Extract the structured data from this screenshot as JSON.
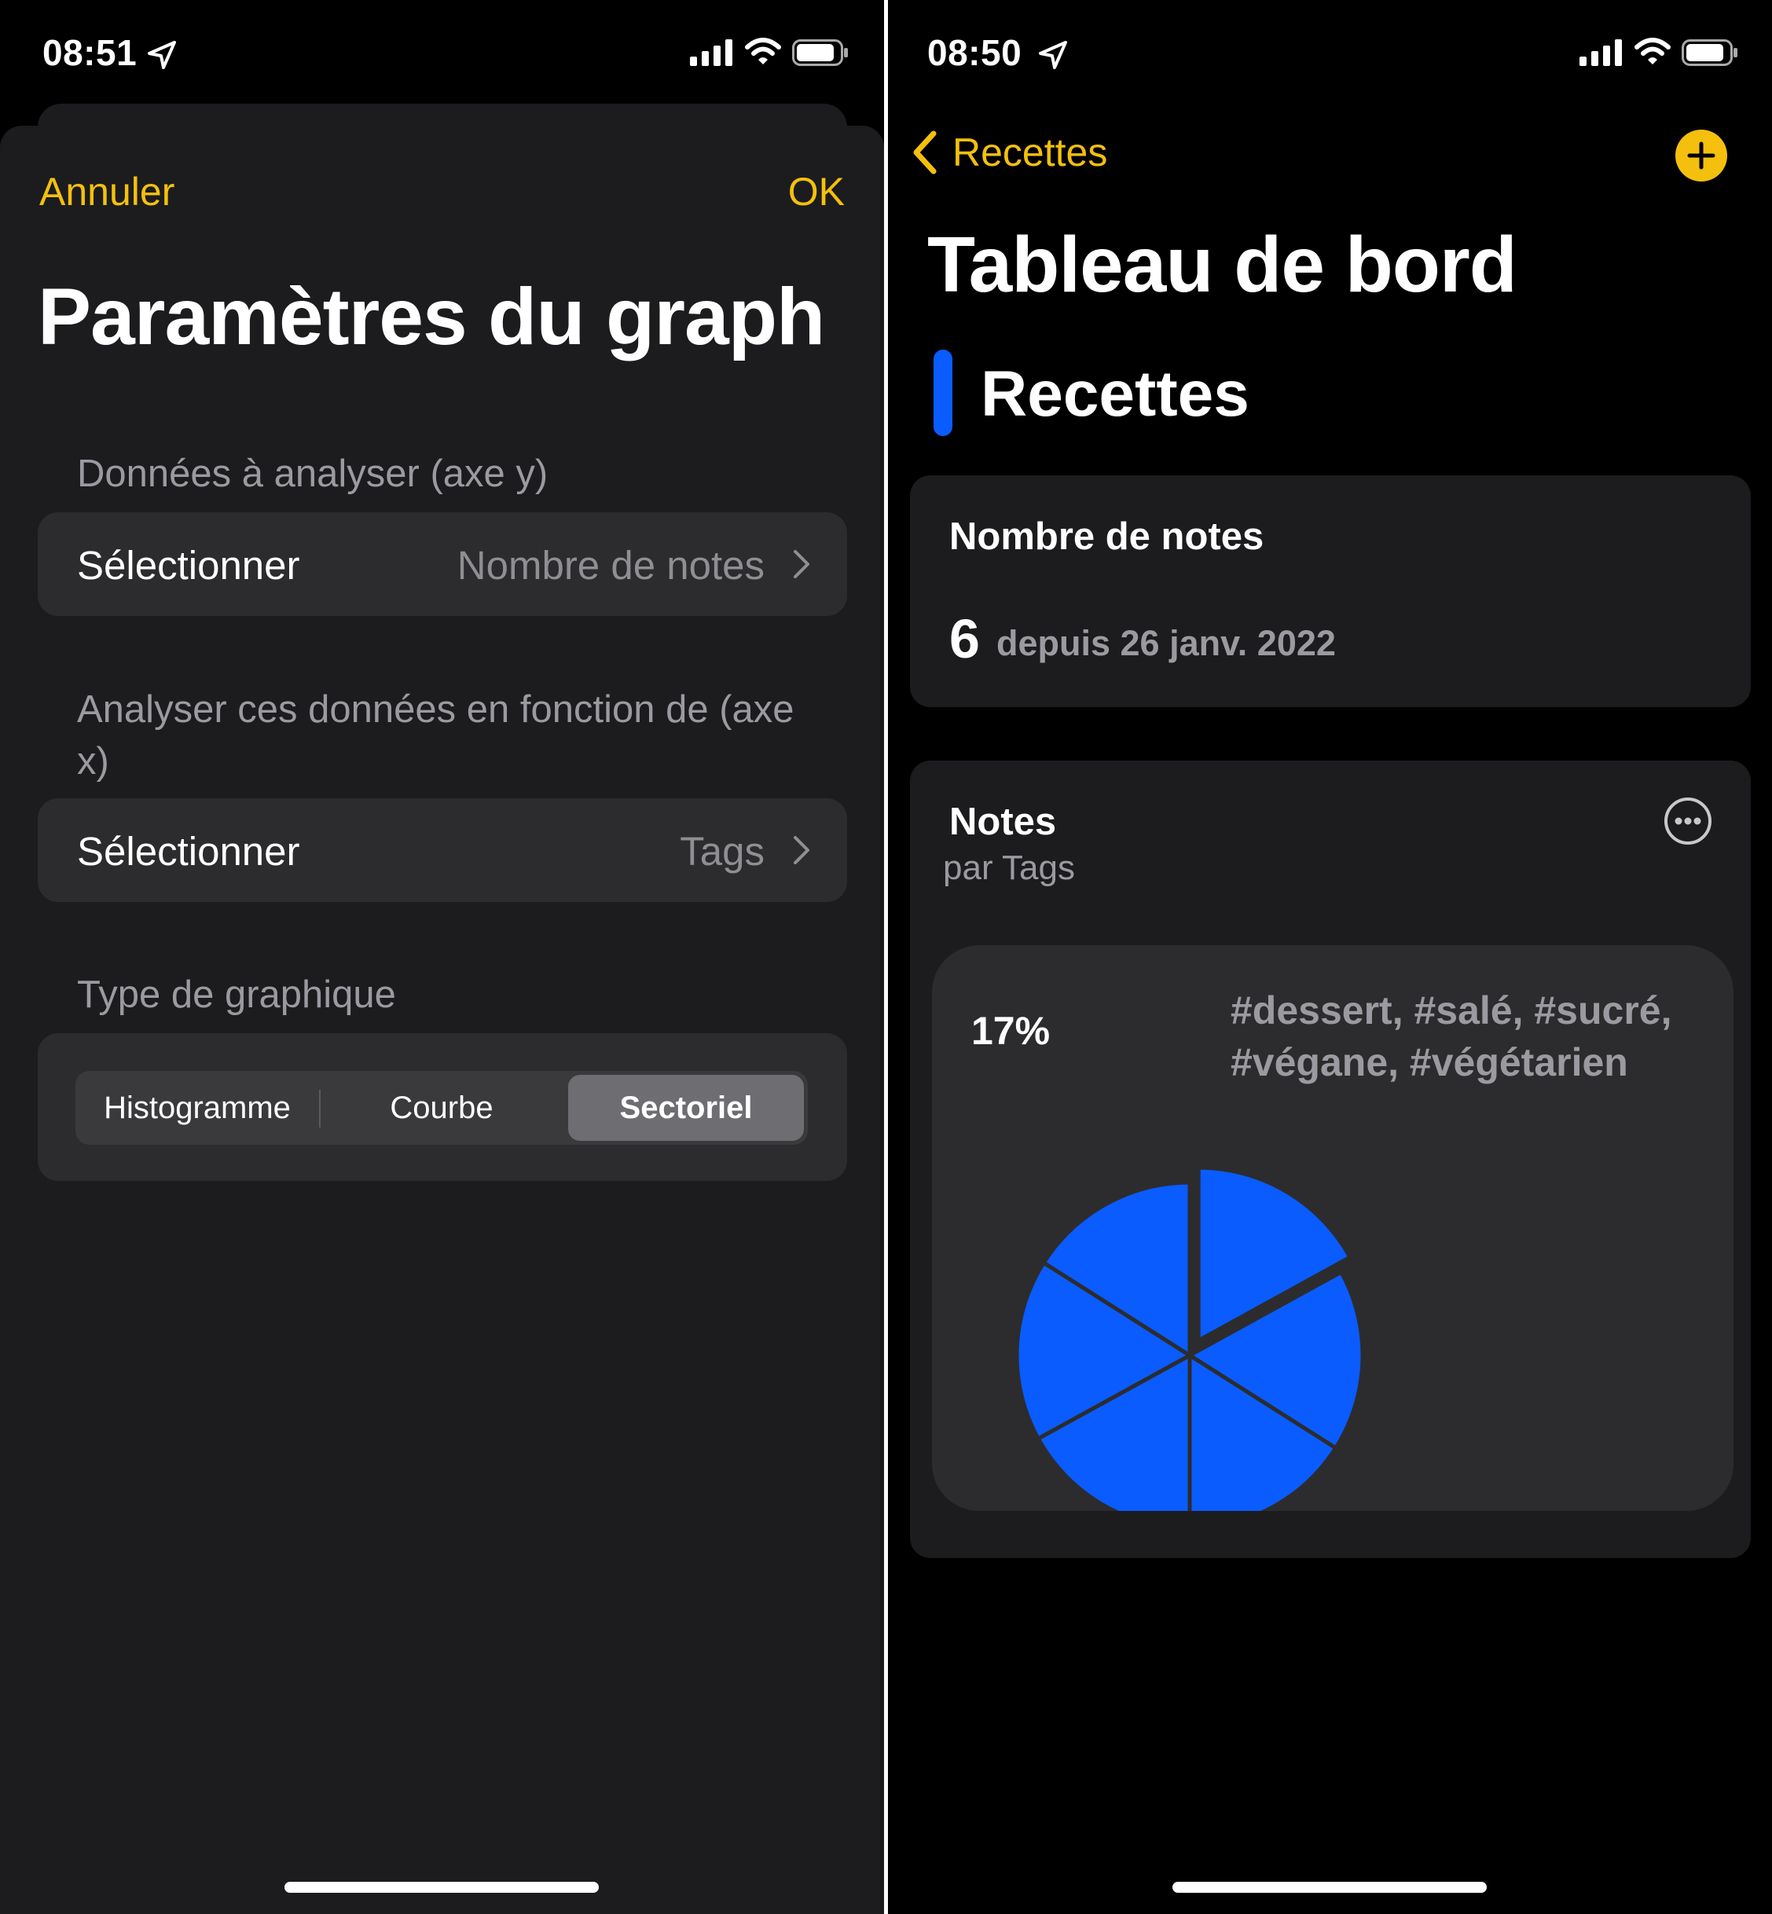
{
  "left": {
    "status": {
      "time": "08:51"
    },
    "nav": {
      "cancel": "Annuler",
      "ok": "OK"
    },
    "title": "Paramètres du graph",
    "y_axis": {
      "header": "Données à analyser (axe y)",
      "label": "Sélectionner",
      "value": "Nombre de notes"
    },
    "x_axis": {
      "header": "Analyser ces données en fonction de (axe x)",
      "label": "Sélectionner",
      "value": "Tags"
    },
    "chart_type": {
      "header": "Type de graphique",
      "options": [
        "Histogramme",
        "Courbe",
        "Sectoriel"
      ],
      "selected": "Sectoriel"
    }
  },
  "right": {
    "status": {
      "time": "08:50"
    },
    "back_label": "Recettes",
    "title": "Tableau de bord",
    "group_title": "Recettes",
    "count_card": {
      "title": "Nombre de notes",
      "number": "6",
      "since": "depuis 26 janv. 2022"
    },
    "chart_card": {
      "title": "Notes",
      "subtitle": "par Tags",
      "highlight_pct": "17%",
      "highlight_label": "#dessert, #salé, #sucré, #végane, #végétarien"
    }
  },
  "colors": {
    "accent": "#f4c00d",
    "series": "#0a5cff",
    "card": "#1c1c1e",
    "row": "#2c2c2e"
  },
  "icons": [
    "location-arrow-icon",
    "cellular-signal-icon",
    "wifi-icon",
    "battery-icon",
    "chevron-right-icon",
    "chevron-left-icon",
    "plus-icon",
    "more-icon"
  ],
  "chart_data": {
    "type": "pie",
    "title": "",
    "slices": [
      {
        "label": "#dessert, #salé, #sucré, #végane, #végétarien",
        "value": 17,
        "highlighted": true
      },
      {
        "label": "",
        "value": 17
      },
      {
        "label": "",
        "value": 16
      },
      {
        "label": "",
        "value": 17
      },
      {
        "label": "",
        "value": 17
      },
      {
        "label": "",
        "value": 16
      }
    ]
  }
}
